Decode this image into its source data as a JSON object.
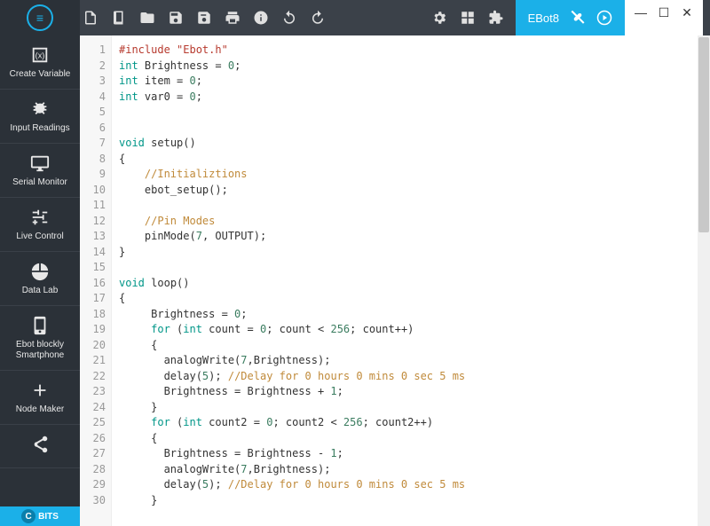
{
  "window": {
    "tab_label": "EBot8"
  },
  "sidebar": {
    "items": [
      {
        "label": "Create Variable",
        "icon": "variable-icon"
      },
      {
        "label": "Input Readings",
        "icon": "bug-icon"
      },
      {
        "label": "Serial Monitor",
        "icon": "monitor-icon"
      },
      {
        "label": "Live Control",
        "icon": "sliders-icon"
      },
      {
        "label": "Data Lab",
        "icon": "piechart-icon"
      },
      {
        "label": "Ebot blockly\nSmartphone",
        "icon": "phone-icon"
      },
      {
        "label": "Node Maker",
        "icon": "plus-icon"
      },
      {
        "label": "",
        "icon": "share-icon"
      }
    ],
    "footer": "BITS"
  },
  "toolbar": {
    "icons": [
      "new-file-icon",
      "book-icon",
      "open-folder-icon",
      "save-icon",
      "save-all-icon",
      "print-icon",
      "info-icon",
      "undo-icon",
      "redo-icon"
    ],
    "mid_icons": [
      "gear-icon",
      "layout-icon",
      "puzzle-icon"
    ],
    "tab_icons": [
      "tools-icon",
      "play-icon"
    ]
  },
  "code": {
    "start_line": 1,
    "lines": [
      [
        [
          "pre",
          "#include "
        ],
        [
          "str",
          "\"Ebot.h\""
        ]
      ],
      [
        [
          "kw",
          "int"
        ],
        [
          "",
          " Brightness = "
        ],
        [
          "num",
          "0"
        ],
        [
          "",
          ";"
        ]
      ],
      [
        [
          "kw",
          "int"
        ],
        [
          "",
          " item = "
        ],
        [
          "num",
          "0"
        ],
        [
          "",
          ";"
        ]
      ],
      [
        [
          "kw",
          "int"
        ],
        [
          "",
          " var0 = "
        ],
        [
          "num",
          "0"
        ],
        [
          "",
          ";"
        ]
      ],
      [],
      [],
      [
        [
          "kw",
          "void"
        ],
        [
          "",
          " "
        ],
        [
          "fn",
          "setup"
        ],
        [
          "",
          "()"
        ]
      ],
      [
        [
          "",
          "{"
        ]
      ],
      [
        [
          "",
          "    "
        ],
        [
          "cm",
          "//Initializtions"
        ]
      ],
      [
        [
          "",
          "    ebot_setup();"
        ]
      ],
      [],
      [
        [
          "",
          "    "
        ],
        [
          "cm",
          "//Pin Modes"
        ]
      ],
      [
        [
          "",
          "    pinMode("
        ],
        [
          "num",
          "7"
        ],
        [
          "",
          ", OUTPUT);"
        ]
      ],
      [
        [
          "",
          "}"
        ]
      ],
      [],
      [
        [
          "kw",
          "void"
        ],
        [
          "",
          " "
        ],
        [
          "fn",
          "loop"
        ],
        [
          "",
          "()"
        ]
      ],
      [
        [
          "",
          "{"
        ]
      ],
      [
        [
          "",
          "     Brightness = "
        ],
        [
          "num",
          "0"
        ],
        [
          "",
          ";"
        ]
      ],
      [
        [
          "",
          "     "
        ],
        [
          "kw",
          "for"
        ],
        [
          "",
          " ("
        ],
        [
          "kw",
          "int"
        ],
        [
          "",
          " count = "
        ],
        [
          "num",
          "0"
        ],
        [
          "",
          "; count < "
        ],
        [
          "num",
          "256"
        ],
        [
          "",
          "; count++)"
        ]
      ],
      [
        [
          "",
          "     {"
        ]
      ],
      [
        [
          "",
          "       analogWrite("
        ],
        [
          "num",
          "7"
        ],
        [
          "",
          ",Brightness);"
        ]
      ],
      [
        [
          "",
          "       delay("
        ],
        [
          "num",
          "5"
        ],
        [
          "",
          "); "
        ],
        [
          "cm",
          "//Delay for 0 hours 0 mins 0 sec 5 ms"
        ]
      ],
      [
        [
          "",
          "       Brightness = Brightness + "
        ],
        [
          "num",
          "1"
        ],
        [
          "",
          ";"
        ]
      ],
      [
        [
          "",
          "     }"
        ]
      ],
      [
        [
          "",
          "     "
        ],
        [
          "kw",
          "for"
        ],
        [
          "",
          " ("
        ],
        [
          "kw",
          "int"
        ],
        [
          "",
          " count2 = "
        ],
        [
          "num",
          "0"
        ],
        [
          "",
          "; count2 < "
        ],
        [
          "num",
          "256"
        ],
        [
          "",
          "; count2++)"
        ]
      ],
      [
        [
          "",
          "     {"
        ]
      ],
      [
        [
          "",
          "       Brightness = Brightness - "
        ],
        [
          "num",
          "1"
        ],
        [
          "",
          ";"
        ]
      ],
      [
        [
          "",
          "       analogWrite("
        ],
        [
          "num",
          "7"
        ],
        [
          "",
          ",Brightness);"
        ]
      ],
      [
        [
          "",
          "       delay("
        ],
        [
          "num",
          "5"
        ],
        [
          "",
          "); "
        ],
        [
          "cm",
          "//Delay for 0 hours 0 mins 0 sec 5 ms"
        ]
      ],
      [
        [
          "",
          "     }"
        ]
      ]
    ]
  }
}
